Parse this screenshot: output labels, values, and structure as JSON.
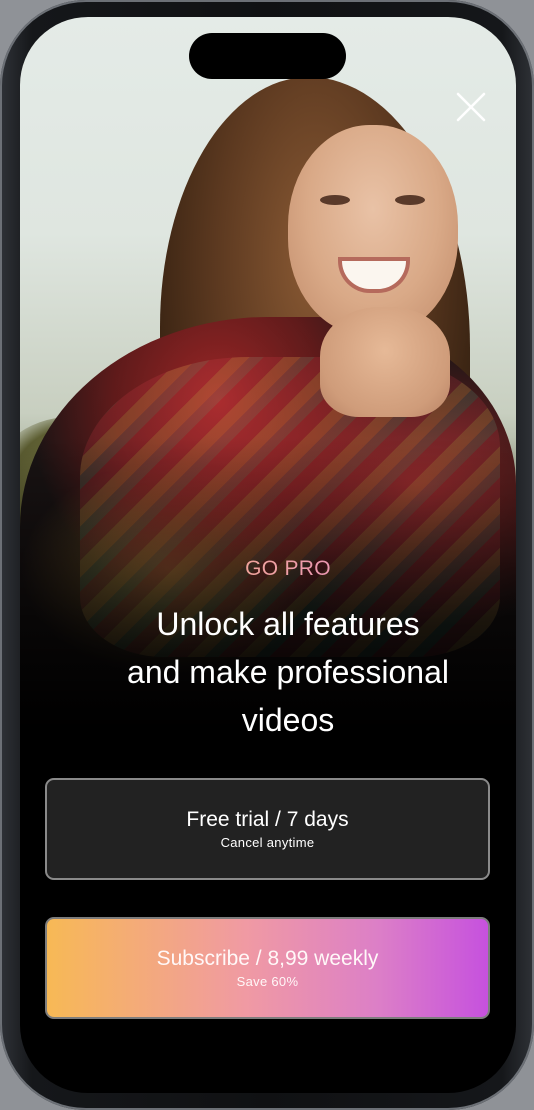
{
  "close": {
    "icon": "close-icon"
  },
  "paywall": {
    "kicker": "GO PRO",
    "headline_lines": [
      "Unlock all features",
      "and make professional",
      "videos"
    ]
  },
  "trial_option": {
    "label": "Free trial / 7 days",
    "sublabel": "Cancel anytime"
  },
  "subscribe_option": {
    "label": "Subscribe / 8,99 weekly",
    "sublabel": "Save 60%"
  },
  "colors": {
    "background": "#000000",
    "trial_button_bg": "#222222",
    "accent_gradient_start": "#f7b955",
    "accent_gradient_mid": "#f09aa3",
    "accent_gradient_end": "#c651de",
    "text": "#ffffff"
  }
}
